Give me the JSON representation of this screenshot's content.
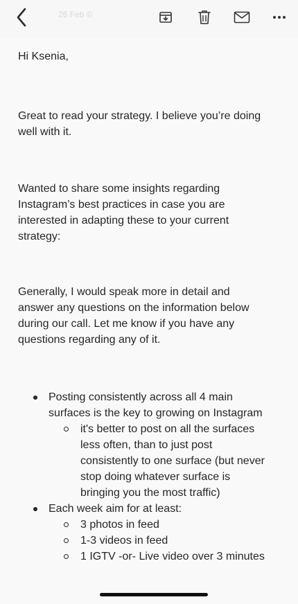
{
  "toolbar": {
    "faded_label": "26 Feb ©",
    "icons": {
      "back": "chevron-left-icon",
      "archive": "archive-icon",
      "delete": "trash-icon",
      "mail": "envelope-icon",
      "more": "more-horizontal-icon"
    }
  },
  "email": {
    "greeting": "Hi Ksenia,",
    "paragraphs": [
      "Great to read your strategy. I believe you’re doing well with it.",
      "Wanted to share some insights regarding Instagram’s best practices in case you are interested in adapting these to your current strategy:",
      "Generally, I would speak more in detail and answer any questions on the information below during our call. Let me know if you have any questions regarding any of it."
    ],
    "bullets": [
      {
        "text": "Posting consistently across all 4 main surfaces is the key to growing on Instagram",
        "subitems": [
          "it's better to post on all the surfaces less often, than to just post consistently to one surface (but never stop doing whatever surface is bringing you the most traffic)"
        ]
      },
      {
        "text": "Each week aim for at least:",
        "subitems": [
          "3 photos in feed",
          "1-3 videos in feed",
          "1 IGTV -or- Live video over 3 minutes"
        ]
      }
    ]
  },
  "colors": {
    "text": "#262626",
    "background": "#f9f9f9",
    "toolbar": "#f7f7f7"
  }
}
